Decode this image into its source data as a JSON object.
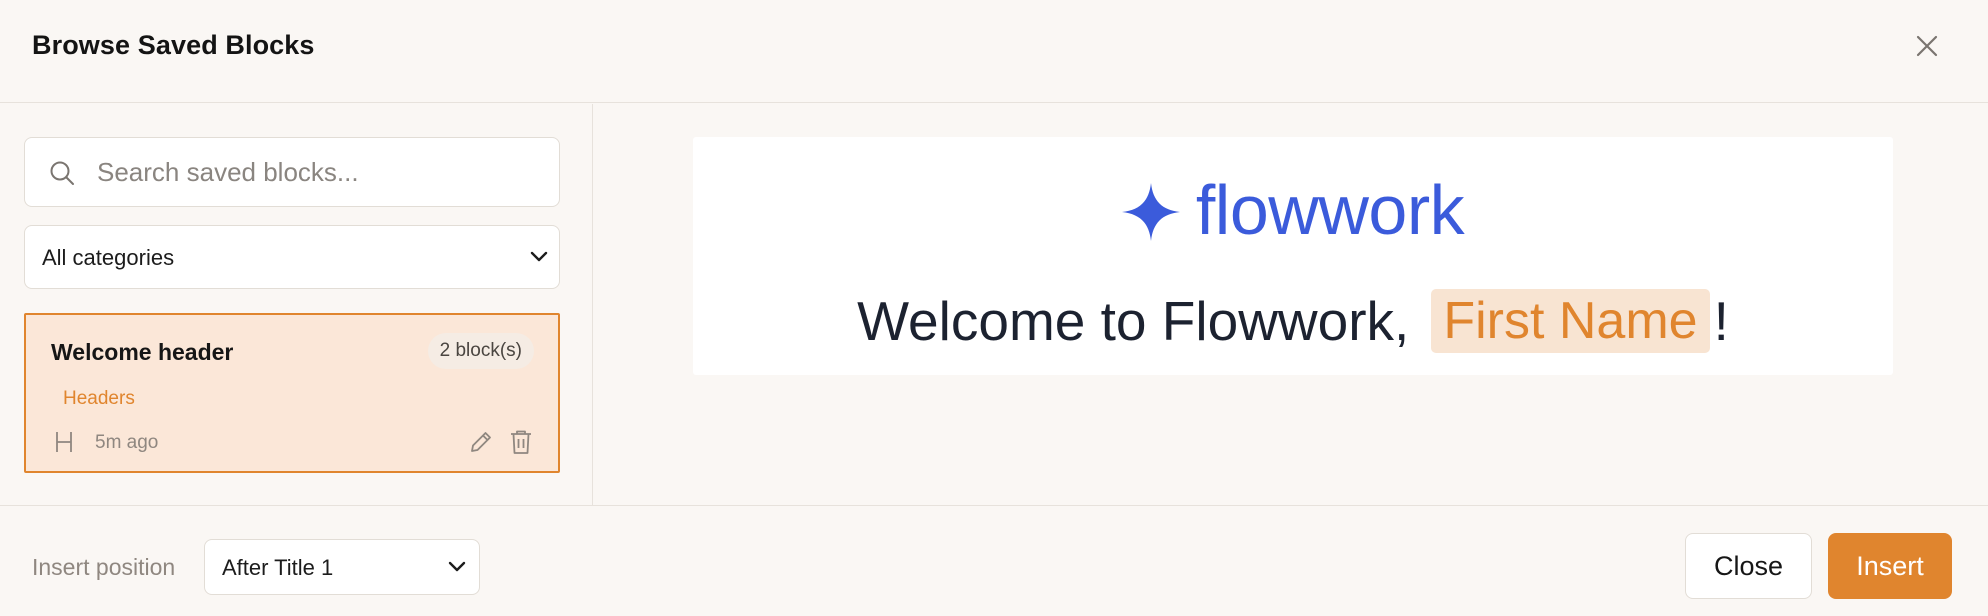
{
  "dialog": {
    "title": "Browse Saved Blocks",
    "close_icon": "close-icon"
  },
  "sidebar": {
    "search": {
      "placeholder": "Search saved blocks...",
      "value": "",
      "icon": "search-icon"
    },
    "category_filter": {
      "selected": "All categories",
      "icon": "chevron-down-icon"
    },
    "blocks": [
      {
        "title": "Welcome header",
        "count_label": "2 block(s)",
        "category": "Headers",
        "type_icon": "heading-icon",
        "time": "5m ago",
        "selected": true
      }
    ]
  },
  "preview": {
    "logo_icon": "sparkle-star-icon",
    "logo_text": "flowwork",
    "welcome_text": "Welcome to Flowwork,",
    "token_label": "First Name",
    "suffix": "!",
    "colors": {
      "brand": "#3b5bdb",
      "accent": "#e0852e"
    }
  },
  "footer": {
    "position_label": "Insert position",
    "position_value": "After Title 1",
    "close_label": "Close",
    "insert_label": "Insert"
  }
}
